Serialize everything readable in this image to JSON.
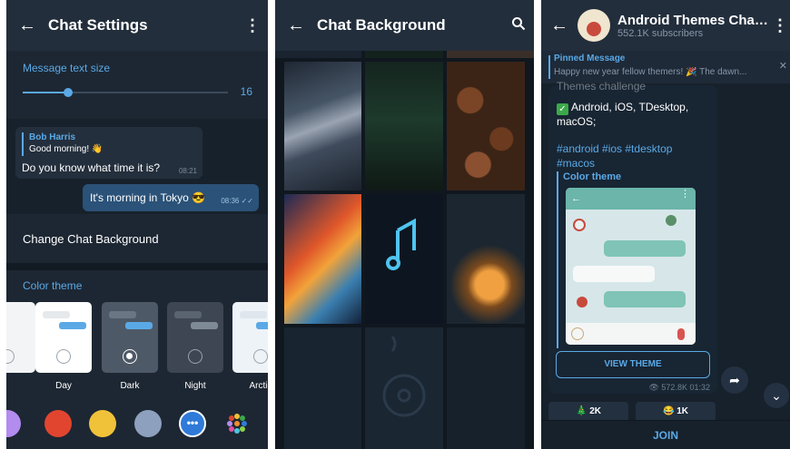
{
  "screen1": {
    "title": "Chat Settings",
    "text_size_label": "Message text size",
    "text_size_value": "16",
    "text_size_fraction": 0.22,
    "preview": {
      "reply_name": "Bob Harris",
      "reply_text": "Good morning! 👋",
      "incoming_text": "Do you know what time it is?",
      "incoming_time": "08:21",
      "outgoing_text": "It's morning in Tokyo 😎",
      "outgoing_time": "08:36"
    },
    "change_background": "Change Chat Background",
    "color_theme_label": "Color theme",
    "themes": [
      {
        "label": "Day"
      },
      {
        "label": "Dark"
      },
      {
        "label": "Night"
      },
      {
        "label": "Arctic"
      }
    ],
    "accent_colors": [
      "#b38cf0",
      "#e2452f",
      "#f0c23a",
      "#8da0be",
      "#2f7ad8",
      "#multi"
    ]
  },
  "screen2": {
    "title": "Chat Background"
  },
  "screen3": {
    "title": "Android Themes Chan...",
    "subtitle": "552.1K subscribers",
    "pinned_label": "Pinned Message",
    "pinned_text": "Happy new year fellow themers! 🎉 The dawn...",
    "post_cut_text": "Themes challenge",
    "platforms_line1": "Android, iOS, TDesktop,",
    "platforms_line2": "macOS;",
    "tags_line1": "#android #ios #tdesktop",
    "tags_line2": "#macos",
    "color_theme_label": "Color theme",
    "view_theme": "VIEW THEME",
    "views": "572.8K",
    "post_time": "01:32",
    "reaction1": "🎄 2K",
    "reaction2": "😂 1K",
    "join": "JOIN"
  }
}
